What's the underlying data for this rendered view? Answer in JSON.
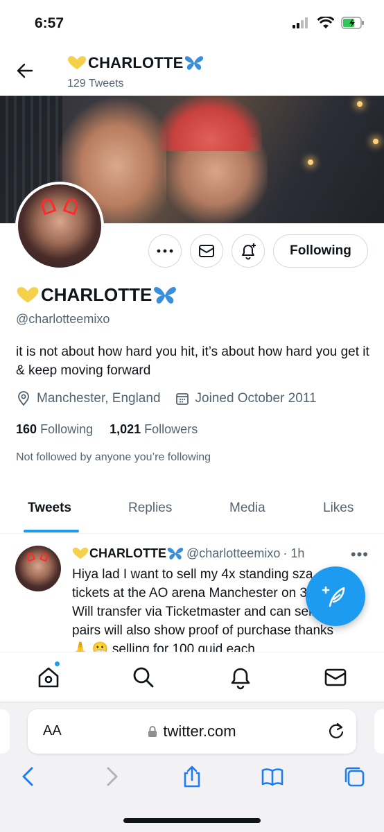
{
  "status": {
    "time": "6:57"
  },
  "profile": {
    "display_name": "CHARLOTTE",
    "tweet_count": "129 Tweets",
    "handle": "@charlotteemixo",
    "bio": "it is not about how hard you hit, it’s about how hard you get it & keep moving forward",
    "location": "Manchester, England",
    "joined": "Joined October 2011",
    "following_count": "160",
    "following_label": "Following",
    "followers_count": "1,021",
    "followers_label": "Followers",
    "not_followed": "Not followed by anyone you’re following",
    "follow_button": "Following"
  },
  "tabs": [
    "Tweets",
    "Replies",
    "Media",
    "Likes"
  ],
  "tweet": {
    "name": "CHARLOTTE",
    "handle": "@charlotteemixo",
    "time": "· 1h",
    "text": "Hiya lad I want to sell my 4x standing sza tickets at the AO arena Manchester on 3 Jun Will transfer via Ticketmaster and can sell in pairs will also show proof of purchase thanks 🙏 😬 selling for 100 quid each"
  },
  "safari": {
    "aa": "AA",
    "url": "twitter.com"
  },
  "colors": {
    "accent": "#1d9bf0",
    "heart": "#f5d04a",
    "butterfly": "#3b8fd9"
  }
}
